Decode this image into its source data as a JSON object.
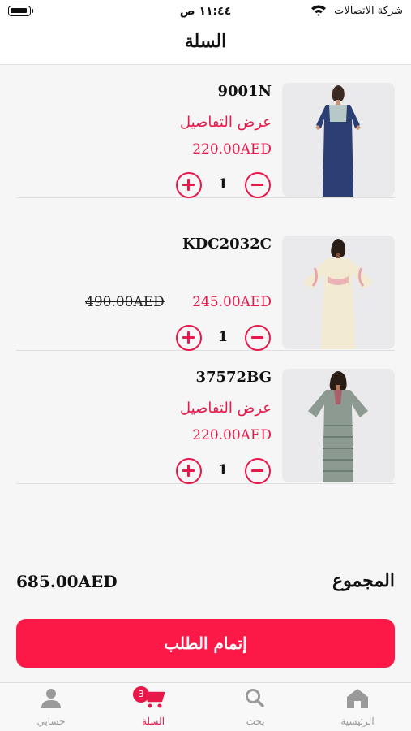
{
  "status_bar": {
    "carrier": "شركة الاتصالات",
    "time": "١١:٤٤ ص"
  },
  "header": {
    "title": "السلة"
  },
  "cart_items": [
    {
      "code": "9001N",
      "details_link": "عرض التفاصيل",
      "price": "220.00AED",
      "quantity": "1",
      "dress_color": "#2b3f74"
    },
    {
      "code": "KDC2032C",
      "price": "245.00AED",
      "old_price": "490.00AED",
      "quantity": "1",
      "dress_color": "#f3ead2"
    },
    {
      "code": "37572BG",
      "details_link": "عرض التفاصيل",
      "price": "220.00AED",
      "quantity": "1",
      "dress_color": "#8d9a91"
    }
  ],
  "total": {
    "label": "المجموع",
    "value": "685.00AED"
  },
  "checkout": {
    "label": "إتمام الطلب"
  },
  "tab_bar": {
    "tabs": [
      {
        "name": "home",
        "label": "الرئيسية",
        "icon": "home-icon"
      },
      {
        "name": "search",
        "label": "بحث",
        "icon": "search-icon"
      },
      {
        "name": "cart",
        "label": "السلة",
        "icon": "cart-icon",
        "badge": "3",
        "active": true
      },
      {
        "name": "account",
        "label": "حسابي",
        "icon": "user-icon"
      }
    ]
  },
  "colors": {
    "accent": "#e8194a",
    "checkout_button": "#fc1948",
    "inactive_tab": "#9a9a9a"
  }
}
